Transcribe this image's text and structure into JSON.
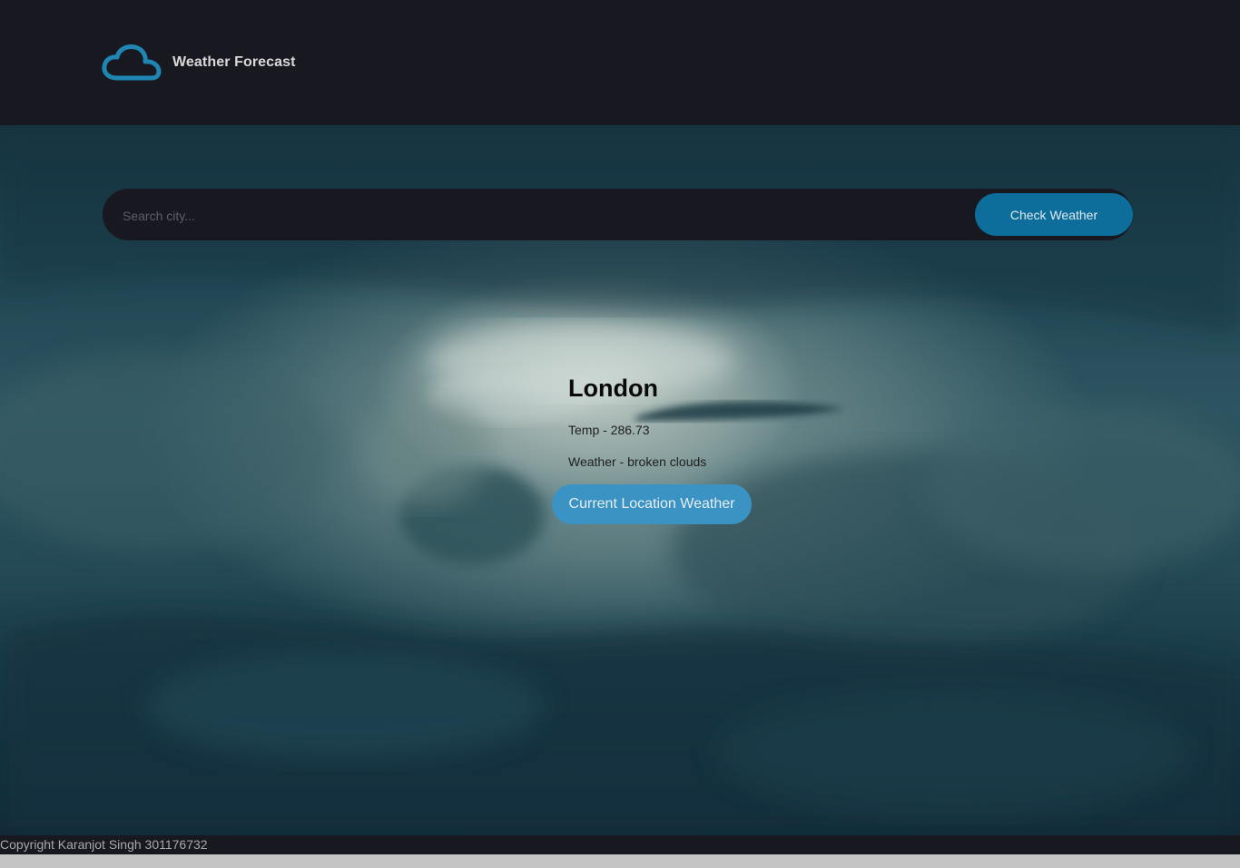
{
  "header": {
    "logo_icon": "cloud-icon",
    "title": "Weather Forecast",
    "accent_color": "#1f86b4"
  },
  "search": {
    "placeholder": "Search city...",
    "value": "",
    "button_label": "Check Weather",
    "button_color": "#0d6e9c"
  },
  "result": {
    "city": "London",
    "temp": "Temp - 286.73",
    "weather": "Weather - broken clouds"
  },
  "location_button": {
    "label": "Current Location Weather",
    "color": "#3a93c3"
  },
  "footer": {
    "text": "Copyright Karanjot Singh 301176732"
  }
}
